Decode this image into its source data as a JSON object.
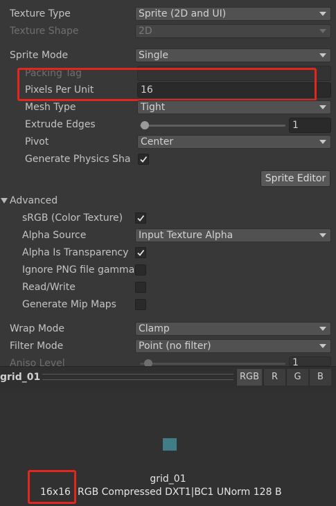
{
  "texture_type": {
    "label": "Texture Type",
    "value": "Sprite (2D and UI)"
  },
  "texture_shape": {
    "label": "Texture Shape",
    "value": "2D"
  },
  "sprite_mode": {
    "label": "Sprite Mode",
    "value": "Single"
  },
  "packing_tag": {
    "label": "Packing Tag",
    "value": ""
  },
  "pixels_per_unit": {
    "label": "Pixels Per Unit",
    "value": "16"
  },
  "mesh_type": {
    "label": "Mesh Type",
    "value": "Tight"
  },
  "extrude_edges": {
    "label": "Extrude Edges",
    "value": "1",
    "level": 0.0
  },
  "pivot": {
    "label": "Pivot",
    "value": "Center"
  },
  "generate_physics_shape": {
    "label": "Generate Physics Sha",
    "checked": true
  },
  "sprite_editor_button": "Sprite Editor",
  "advanced": {
    "label": "Advanced",
    "srgb": {
      "label": "sRGB (Color Texture)",
      "checked": true
    },
    "alpha_source": {
      "label": "Alpha Source",
      "value": "Input Texture Alpha"
    },
    "alpha_is_transparency": {
      "label": "Alpha Is Transparency",
      "checked": true
    },
    "ignore_png_gamma": {
      "label": "Ignore PNG file gamma",
      "checked": false
    },
    "read_write": {
      "label": "Read/Write",
      "checked": false
    },
    "generate_mip_maps": {
      "label": "Generate Mip Maps",
      "checked": false
    }
  },
  "wrap_mode": {
    "label": "Wrap Mode",
    "value": "Clamp"
  },
  "filter_mode": {
    "label": "Filter Mode",
    "value": "Point (no filter)"
  },
  "aniso_level": {
    "label": "Aniso Level",
    "value": "1",
    "level": 0.0
  },
  "preview": {
    "title": "grid_01",
    "channels": [
      "RGB",
      "R",
      "G",
      "B"
    ],
    "active_channel": "RGB",
    "asset_name": "grid_01",
    "size": "16x16",
    "format_info": "RGB Compressed DXT1|BC1 UNorm   128 B",
    "sprite_color": "#3f7d87"
  },
  "highlight_color": "#e5261f"
}
